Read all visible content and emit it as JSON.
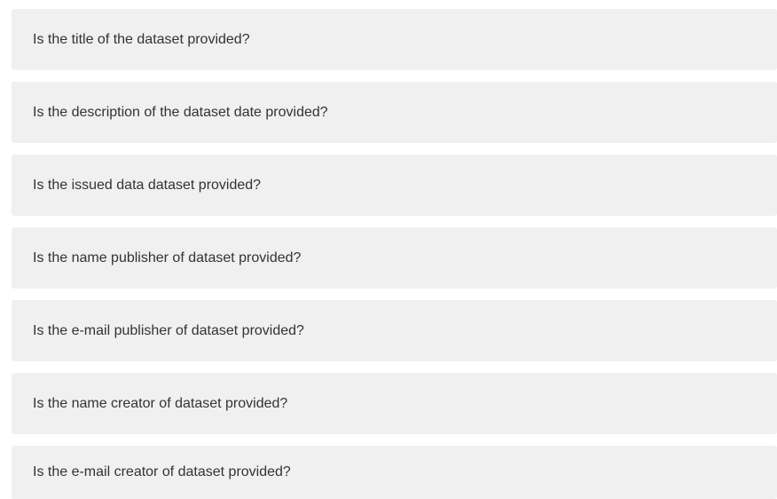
{
  "questions": [
    {
      "label": "Is the title of the dataset provided?"
    },
    {
      "label": "Is the description of the dataset date provided?"
    },
    {
      "label": "Is the issued data dataset provided?"
    },
    {
      "label": "Is the name publisher of dataset provided?"
    },
    {
      "label": "Is the e-mail publisher of dataset provided?"
    },
    {
      "label": "Is the name creator of dataset provided?"
    },
    {
      "label": "Is the e-mail creator of dataset provided?"
    }
  ],
  "colors": {
    "panel_background": "#f0f0f0",
    "text": "#333333",
    "page_background": "#ffffff"
  }
}
